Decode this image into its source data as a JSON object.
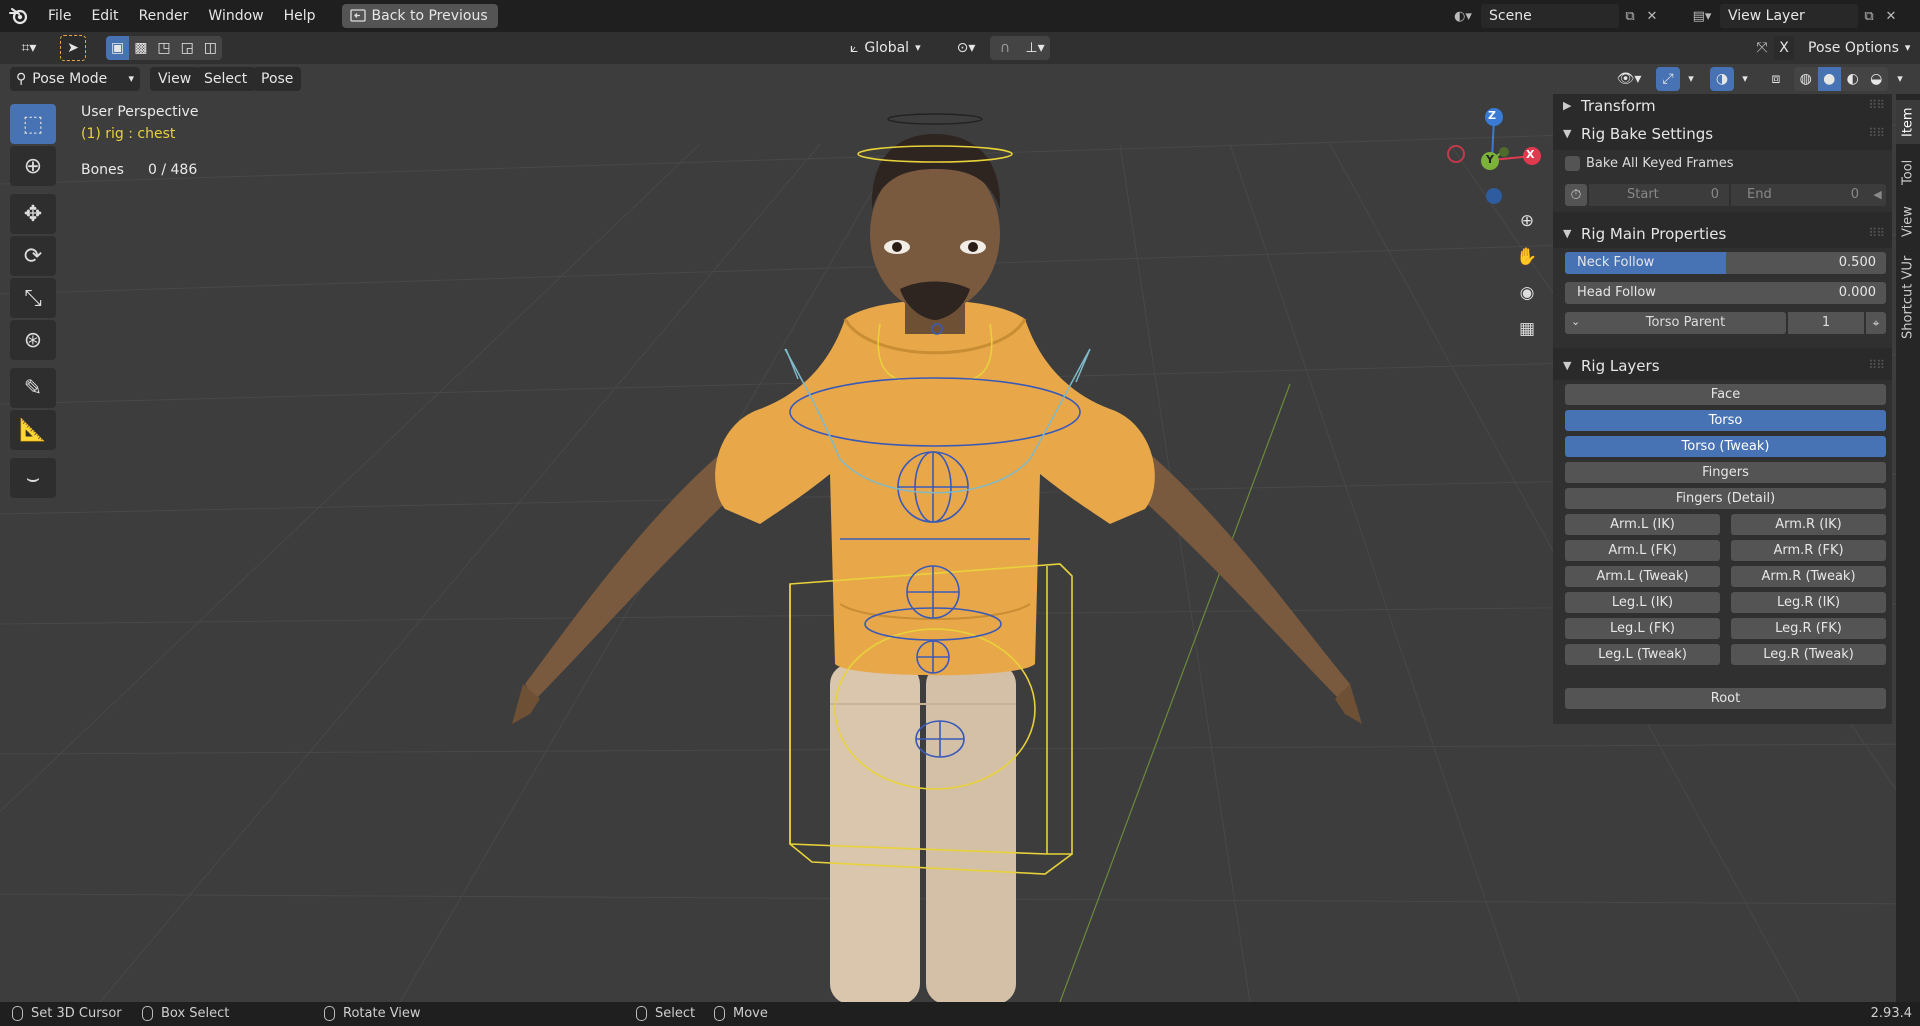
{
  "topbar": {
    "menus": [
      "File",
      "Edit",
      "Render",
      "Window",
      "Help"
    ],
    "back_button": "Back to Previous",
    "scene": "Scene",
    "view_layer": "View Layer"
  },
  "header": {
    "transform_orientation": "Global",
    "pose_options": "Pose Options",
    "mode": "Pose Mode",
    "view_menus": [
      "View",
      "Select",
      "Pose"
    ]
  },
  "viewport": {
    "perspective": "User Perspective",
    "active_object": "(1) rig : chest",
    "bones_label": "Bones",
    "bones_value": "0 / 486",
    "gizmo": {
      "z": "Z",
      "y": "Y",
      "x": "X"
    }
  },
  "npanel": {
    "transform_title": "Transform",
    "bake_title": "Rig Bake Settings",
    "bake_all_label": "Bake All Keyed Frames",
    "bake_all_checked": false,
    "start_label": "Start",
    "start_value": "0",
    "end_label": "End",
    "end_value": "0",
    "main_props_title": "Rig Main Properties",
    "neck_follow_label": "Neck Follow",
    "neck_follow_value": "0.500",
    "neck_follow_fraction": 0.5,
    "head_follow_label": "Head Follow",
    "head_follow_value": "0.000",
    "torso_parent_label": "Torso Parent",
    "torso_parent_value": "1",
    "layers_title": "Rig Layers",
    "layers_full": [
      {
        "label": "Face",
        "on": false
      },
      {
        "label": "Torso",
        "on": true
      },
      {
        "label": "Torso (Tweak)",
        "on": true
      },
      {
        "label": "Fingers",
        "on": false
      },
      {
        "label": "Fingers (Detail)",
        "on": false
      }
    ],
    "layers_pairs": [
      [
        "Arm.L (IK)",
        "Arm.R (IK)"
      ],
      [
        "Arm.L (FK)",
        "Arm.R (FK)"
      ],
      [
        "Arm.L (Tweak)",
        "Arm.R (Tweak)"
      ],
      [
        "Leg.L (IK)",
        "Leg.R (IK)"
      ],
      [
        "Leg.L (FK)",
        "Leg.R (FK)"
      ],
      [
        "Leg.L (Tweak)",
        "Leg.R (Tweak)"
      ]
    ],
    "root_label": "Root"
  },
  "sidebar_tabs": [
    "Item",
    "Tool",
    "View",
    "Shortcut VUr"
  ],
  "statusbar": {
    "set_cursor": "Set 3D Cursor",
    "box_select": "Box Select",
    "rotate_view": "Rotate View",
    "select": "Select",
    "move": "Move",
    "version": "2.93.4"
  },
  "colors": {
    "accent": "#4772b3",
    "hoodie": "#e8a84a",
    "skin": "#7a5a3e",
    "pants": "#d9c6ad",
    "bone_yellow": "#e8d23a",
    "bone_blue": "#3a5ab8",
    "bone_cyan": "#7fb9c9"
  }
}
